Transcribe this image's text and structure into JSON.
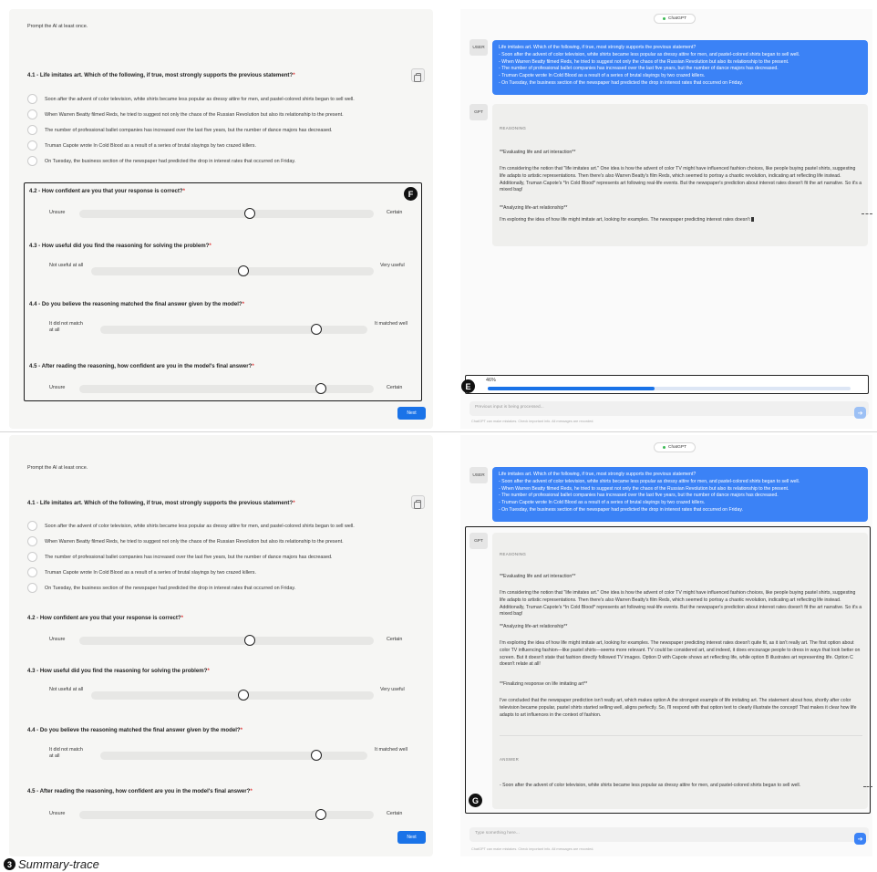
{
  "survey": {
    "prompt_note": "Prompt the AI at least once.",
    "question": {
      "title": "4.1 - Life imitates art. Which of the following, if true, most strongly supports the previous statement?",
      "required_mark": "*",
      "options": [
        "Soon after the advent of color television, white shirts became less popular as dressy attire for men, and pastel-colored shirts began to sell well.",
        "When Warren Beatty filmed Reds, he tried to suggest not only the chaos of the Russian Revolution but also its relationship to the present.",
        "The number of professional ballet companies has increased over the last five years, but the number of dance majors has decreased.",
        "Truman Capote wrote In Cold Blood as a result of a series of brutal slayings by two crazed killers.",
        "On Tuesday, the business section of the newspaper had predicted the drop in interest rates that occurred on Friday."
      ]
    },
    "sliders": [
      {
        "title": "4.2 - How confident are you that your response is correct?",
        "left": "Unsure",
        "right": "Certain",
        "value": 0.58
      },
      {
        "title": "4.3 - How useful did you find the reasoning for solving the problem?",
        "left": "Not useful at all",
        "right": "Very useful",
        "value": 0.54
      },
      {
        "title": "4.4 - Do you believe the reasoning matched the final answer given by the model?",
        "left": "It did not match at all",
        "right": "It matched well",
        "value": 0.81
      },
      {
        "title": "4.5 - After reading the reasoning, how confident are you in the model's final answer?",
        "left": "Unsure",
        "right": "Certain",
        "value": 0.82
      }
    ],
    "next_label": "Next"
  },
  "chat": {
    "model_chip": "ChatGPT",
    "user_label": "USER",
    "gpt_label": "GPT",
    "user_message": [
      "Life imitates art. Which of the following, if true, most strongly supports the previous statement?",
      "- Soon after the advent of color television, white shirts became less popular as dressy attire for men, and pastel-colored shirts began to sell well.",
      "- When Warren Beatty filmed Reds, he tried to suggest not only the chaos of the Russian Revolution but also its relationship to the present.",
      "- The number of professional ballet companies has increased over the last five years, but the number of dance majors has decreased.",
      "- Truman Capote wrote In Cold Blood as a result of a series of brutal slayings by two crazed killers.",
      "- On Tuesday, the business section of the newspaper had predicted the drop in interest rates that occurred on Friday."
    ],
    "reasoning_label": "REASONING",
    "answer_label": "ANSWER",
    "reasoning_head": "**Evaluating life and art interaction**",
    "reasoning_p1": "I'm considering the notion that \"life imitates art.\" One idea is how the advent of color TV might have influenced fashion choices, like people buying pastel shirts, suggesting life adapts to artistic representations. Then there's also Warren Beatty's film Reds, which seemed to portray a chaotic revolution, indicating art reflecting life instead. Additionally, Truman Capote's *In Cold Blood* represents art following real-life events. But the newspaper's prediction about interest rates doesn't fit the art narrative. So it's a mixed bag!",
    "reasoning_head2": "**Analyzing life-art relationship**",
    "reasoning_p2_partial": "I'm exploring the idea of how life might imitate art, looking for examples. The newspaper predicting interest rates doesn't",
    "reasoning_p2_full": "I'm exploring the idea of how life might imitate art, looking for examples. The newspaper predicting interest rates doesn't quite fit, as it isn't really art. The first option about color TV influencing fashion—like pastel shirts—seems more relevant. TV could be considered art, and indeed, it does encourage people to dress in ways that look better on screen. But it doesn't state that fashion directly followed TV images. Option D with Capote shows art reflecting life, while option B illustrates art representing life. Option C doesn't relate at all!",
    "reasoning_head3": "**Finalizing response on life imitating art**",
    "reasoning_p3": "I've concluded that the newspaper prediction isn't really art, which makes option A the strongest example of life imitating art. The statement about how, shortly after color television became popular, pastel shirts started selling well, aligns perfectly. So, I'll respond with that option text to clearly illustrate the concept! That makes it clear how life adapts to art influences in the context of fashion.",
    "answer_text": "- Soon after the advent of color television, white shirts became less popular as dressy attire for men, and pastel-colored shirts began to sell well.",
    "progress_text": "46%",
    "progress_value": 0.46,
    "input_placeholder_busy": "Previous input is being processed...",
    "input_placeholder": "Type something here...",
    "disclaimer": "ChatGPT can make mistakes. Check important info. All messages are recorded."
  },
  "badges": {
    "f": "F",
    "e": "E",
    "g": "G"
  },
  "caption": {
    "number": "3",
    "text": "Summary-trace"
  },
  "colors": {
    "accent": "#1a73e8",
    "user_bubble": "#3b82f6",
    "required": "#e23b3b"
  }
}
